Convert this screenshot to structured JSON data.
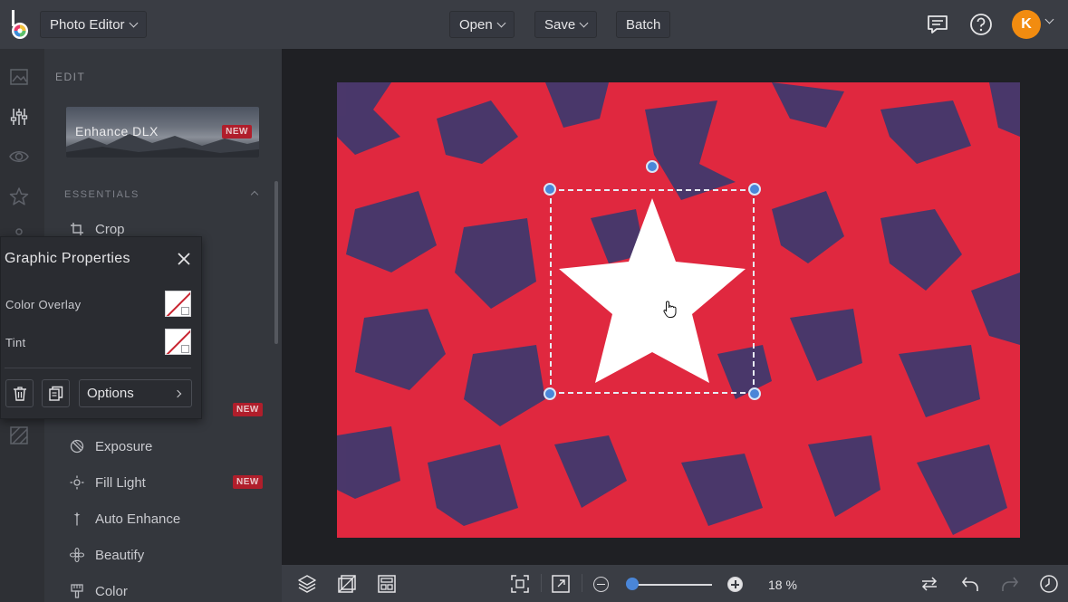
{
  "header": {
    "app_name": "Photo Editor",
    "menu": {
      "open": "Open",
      "save": "Save",
      "batch": "Batch"
    },
    "user_initial": "K"
  },
  "panel": {
    "title": "EDIT",
    "enhance_card": {
      "label": "Enhance DLX",
      "badge": "NEW"
    },
    "section": "ESSENTIALS",
    "tools": [
      {
        "label": "Crop"
      },
      {
        "label": "Exposure"
      },
      {
        "label": "Fill Light",
        "badge": "NEW"
      },
      {
        "label": "Auto Enhance"
      },
      {
        "label": "Beautify"
      },
      {
        "label": "Color"
      }
    ],
    "hidden_row_badge": "NEW"
  },
  "graphic_properties": {
    "title": "Graphic Properties",
    "color_overlay": "Color Overlay",
    "tint": "Tint",
    "options": "Options"
  },
  "canvas": {
    "photo_color": "#e0283f",
    "shadow_color": "#2f3a72"
  },
  "bottom": {
    "zoom_label": "18 %",
    "zoom_level": 0.0
  },
  "colors": {
    "accent": "#4a86d8",
    "avatar": "#f28c10",
    "badge": "#b01e2b"
  }
}
